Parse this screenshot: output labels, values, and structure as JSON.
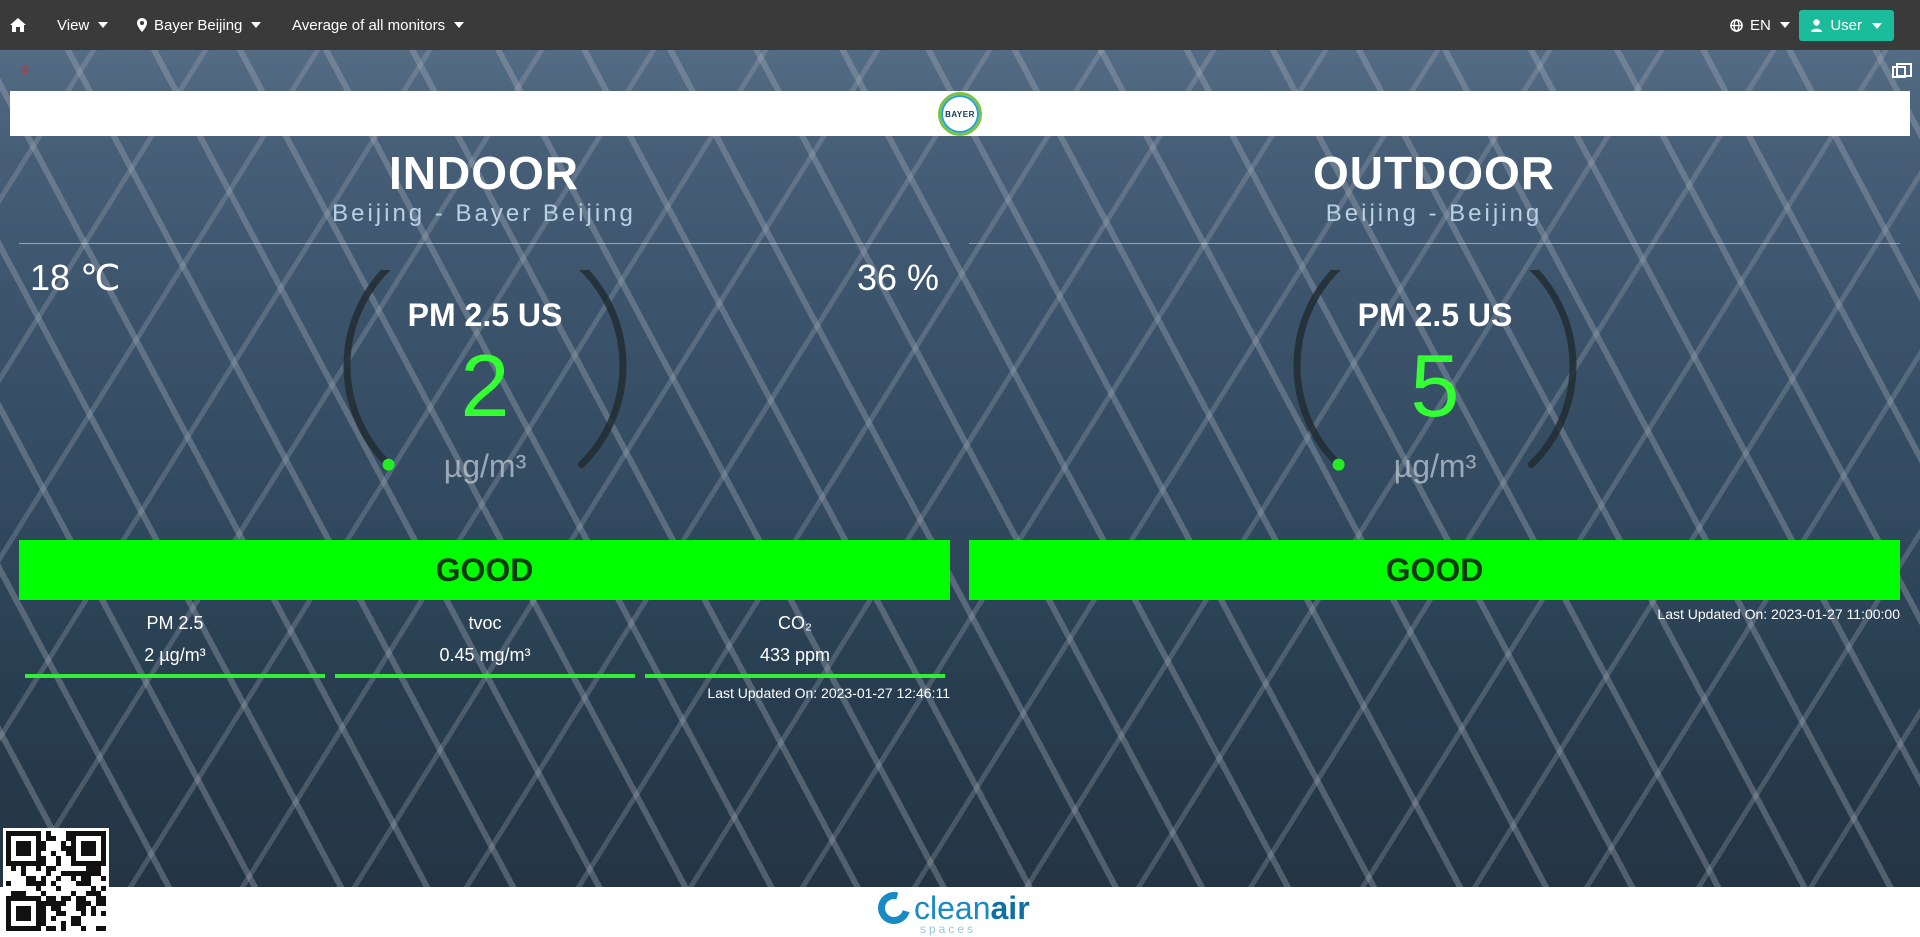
{
  "nav": {
    "home_icon": "home-icon",
    "view_label": "View",
    "location_label": "Bayer Beijing",
    "monitors_label": "Average of all monitors",
    "language_label": "EN",
    "user_label": "User"
  },
  "brand": {
    "header_logo_text": "BAYER",
    "footer_name_regular": "clean",
    "footer_name_bold": "air",
    "footer_sub": "spaces"
  },
  "indoor": {
    "title": "INDOOR",
    "subtitle": "Beijing - Bayer Beijing",
    "temperature": "18 ℃",
    "humidity": "36 %",
    "gauge_label": "PM 2.5 US",
    "gauge_value": "2",
    "gauge_unit": "µg/m³",
    "gauge_level": 0.0,
    "status": "GOOD",
    "metrics": [
      {
        "name": "PM 2.5",
        "value": "2 µg/m³"
      },
      {
        "name": "tvoc",
        "value": "0.45 mg/m³"
      },
      {
        "name": "CO₂",
        "value": "433 ppm"
      }
    ],
    "last_updated": "Last Updated On: 2023-01-27 12:46:11"
  },
  "outdoor": {
    "title": "OUTDOOR",
    "subtitle": "Beijing - Beijing",
    "gauge_label": "PM 2.5 US",
    "gauge_value": "5",
    "gauge_unit": "µg/m³",
    "gauge_level": 0.0,
    "status": "GOOD",
    "last_updated": "Last Updated On: 2023-01-27 11:00:00"
  },
  "colors": {
    "status_good": "#00ff00",
    "gauge_value": "#33ff33",
    "nav_bg": "#3a3a3a",
    "user_button": "#1bbc9b"
  }
}
